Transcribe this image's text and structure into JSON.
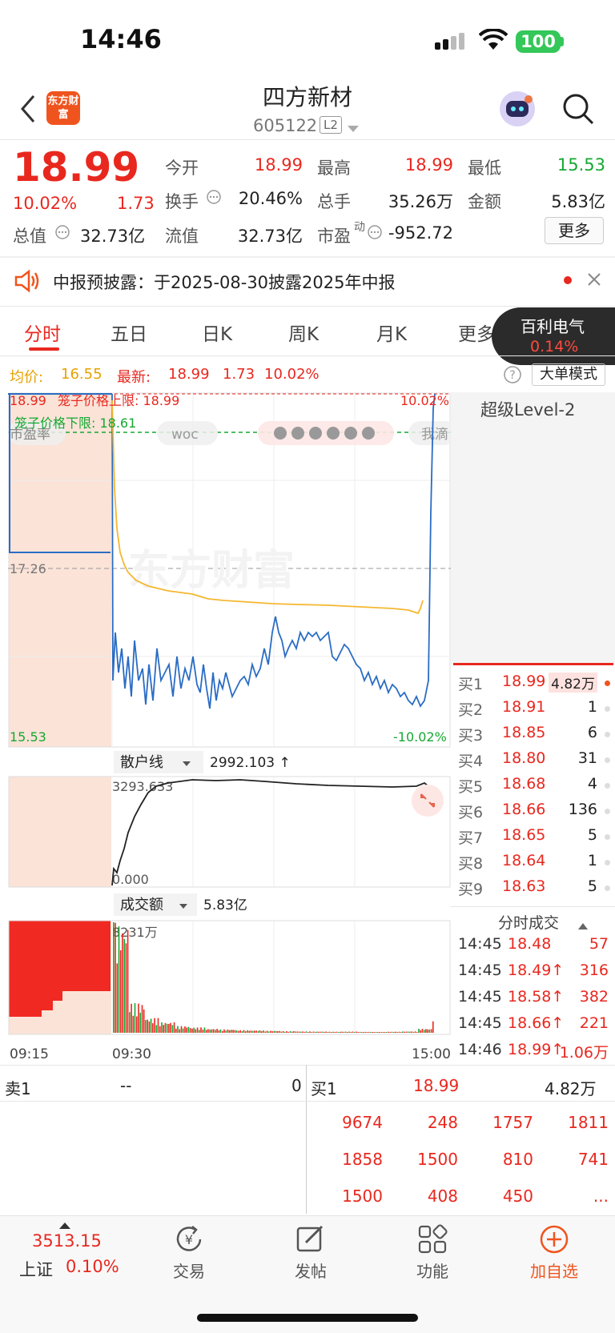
{
  "status_bar": {
    "time": "14:46",
    "battery": "100"
  },
  "header": {
    "logo_text": "东方财富",
    "title": "四方新材",
    "code": "605122",
    "level_badge": "L2"
  },
  "quote": {
    "price": "18.99",
    "change_pct": "10.02%",
    "change": "1.73",
    "total_value_label": "总值",
    "total_value": "32.73亿",
    "open_label": "今开",
    "open": "18.99",
    "turnover_label": "换手",
    "turnover": "20.46%",
    "float_value_label": "流值",
    "float_value": "32.73亿",
    "high_label": "最高",
    "high": "18.99",
    "volume_label": "总手",
    "volume": "35.26万",
    "pe_label": "市盈",
    "pe_sup": "动",
    "pe": "-952.72",
    "low_label": "最低",
    "low": "15.53",
    "amount_label": "金额",
    "amount": "5.83亿",
    "more_label": "更多"
  },
  "notice": {
    "text": "中报预披露：于2025-08-30披露2025年中报"
  },
  "tabs": [
    "分时",
    "五日",
    "日K",
    "周K",
    "月K",
    "更多"
  ],
  "float_stock": {
    "name": "百利电气",
    "change": "0.14%"
  },
  "chart_info": {
    "avg_label": "均价:",
    "avg": "16.55",
    "latest_label": "最新:",
    "latest": "18.99",
    "latest_change": "1.73",
    "latest_pct": "10.02%",
    "bigorder_label": "大单模式"
  },
  "chart_labels": {
    "top_price": "18.99",
    "cage_upper": "笼子价格上限: 18.99",
    "top_pct": "10.02%",
    "cage_lower": "笼子价格下限: 18.61",
    "mid_price": "17.26",
    "bottom_price": "15.53",
    "bottom_pct": "-10.02%",
    "watermark": "东方财富",
    "pill_left": "市盈率",
    "pill_mid": "woc",
    "pill_right": "我滴",
    "retail_label": "散户线",
    "retail_value": "2992.103 ↑",
    "retail_top": "3293.633",
    "retail_bottom": "0.000",
    "amount_label": "成交额",
    "amount_value": "5.83亿",
    "amount_top": "8231万",
    "time_start": "09:15",
    "time_open": "09:30",
    "time_end": "15:00"
  },
  "chart_data": [
    {
      "type": "line",
      "title": "",
      "series": [
        {
          "name": "",
          "x": [
            "09:30",
            "09:31",
            "09:35",
            "09:45",
            "10:00",
            "10:15",
            "10:30",
            "10:45",
            "11:00",
            "11:15",
            "11:30",
            "13:00",
            "13:15",
            "13:30",
            "13:45",
            "14:00",
            "14:15",
            "14:30",
            "14:40",
            "14:44",
            "14:45",
            "14:46"
          ],
          "values": [
            18.99,
            16.2,
            16.0,
            15.95,
            15.8,
            15.85,
            15.7,
            15.9,
            15.75,
            15.8,
            16.05,
            16.3,
            16.2,
            16.25,
            16.1,
            15.95,
            15.75,
            15.7,
            15.6,
            15.53,
            17.2,
            18.99
          ]
        },
        {
          "name": "均价",
          "x": [
            "09:30",
            "09:35",
            "10:00",
            "10:30",
            "11:30",
            "14:00",
            "14:40",
            "14:45",
            "14:46"
          ],
          "values": [
            18.9,
            17.5,
            16.9,
            16.7,
            16.6,
            16.58,
            16.55,
            16.5,
            16.55
          ]
        }
      ],
      "ylim": [
        15.53,
        18.99
      ]
    },
    {
      "type": "line",
      "title": "",
      "series": [
        {
          "name": "散户线",
          "x": [
            "09:30",
            "09:45",
            "10:00",
            "10:30",
            "11:30",
            "13:30",
            "14:30",
            "14:46"
          ],
          "values": [
            300,
            2000,
            3000,
            3290,
            3250,
            3210,
            3180,
            3240
          ]
        }
      ],
      "ylim": [
        0,
        3293.633
      ]
    },
    {
      "type": "bar",
      "title": "",
      "series": [
        {
          "name": "成交额",
          "values": [
            8231,
            2200,
            1100,
            800,
            500,
            400,
            300,
            250,
            200,
            180,
            150,
            120,
            100,
            90,
            80,
            90,
            70,
            60,
            80,
            100,
            300,
            1200
          ]
        }
      ],
      "ylim": [
        0,
        8231
      ]
    }
  ],
  "level2": {
    "title": "超级Level-2"
  },
  "bids": [
    {
      "label": "买1",
      "price": "18.99",
      "vol": "4.82万"
    },
    {
      "label": "买2",
      "price": "18.91",
      "vol": "1"
    },
    {
      "label": "买3",
      "price": "18.85",
      "vol": "6"
    },
    {
      "label": "买4",
      "price": "18.80",
      "vol": "31"
    },
    {
      "label": "买5",
      "price": "18.68",
      "vol": "4"
    },
    {
      "label": "买6",
      "price": "18.66",
      "vol": "136"
    },
    {
      "label": "买7",
      "price": "18.65",
      "vol": "5"
    },
    {
      "label": "买8",
      "price": "18.64",
      "vol": "1"
    },
    {
      "label": "买9",
      "price": "18.63",
      "vol": "5"
    }
  ],
  "ticks_title": "分时成交",
  "ticks": [
    {
      "time": "14:45",
      "price": "18.48",
      "vol": "57"
    },
    {
      "time": "14:45",
      "price": "18.49↑",
      "vol": "316"
    },
    {
      "time": "14:45",
      "price": "18.58↑",
      "vol": "382"
    },
    {
      "time": "14:45",
      "price": "18.66↑",
      "vol": "221"
    },
    {
      "time": "14:46",
      "price": "18.99↑",
      "vol": "1.06万"
    }
  ],
  "book_summary": {
    "ask_label": "卖1",
    "ask_price": "--",
    "ask_vol": "0",
    "bid_label": "买1",
    "bid_price": "18.99",
    "bid_vol": "4.82万",
    "queue": [
      [
        "9674",
        "248",
        "1757",
        "1811"
      ],
      [
        "1858",
        "1500",
        "810",
        "741"
      ],
      [
        "1500",
        "408",
        "450",
        "..."
      ]
    ]
  },
  "nav": {
    "index_value": "3513.15",
    "index_name": "上证",
    "index_pct": "0.10%",
    "items": [
      "交易",
      "发帖",
      "功能",
      "加自选"
    ]
  }
}
